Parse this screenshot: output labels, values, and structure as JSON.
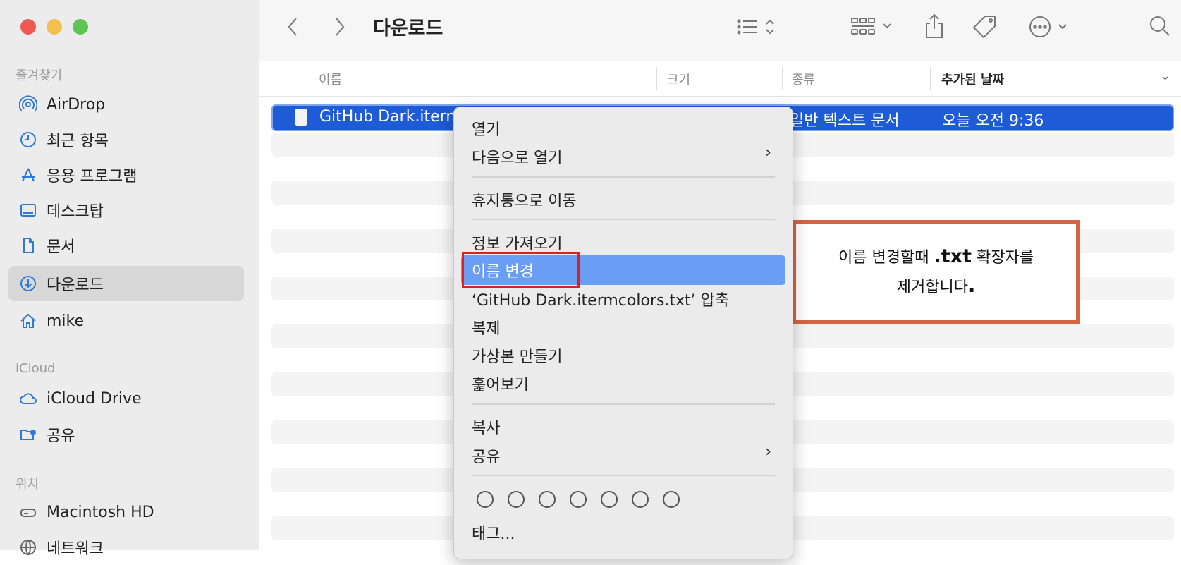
{
  "window": {
    "title": "다운로드"
  },
  "sidebar": {
    "sections": [
      {
        "title": "즐겨찾기",
        "items": [
          {
            "label": "AirDrop",
            "icon": "airdrop-icon"
          },
          {
            "label": "최근 항목",
            "icon": "clock-icon"
          },
          {
            "label": "응용 프로그램",
            "icon": "applications-icon"
          },
          {
            "label": "데스크탑",
            "icon": "desktop-icon"
          },
          {
            "label": "문서",
            "icon": "document-icon"
          },
          {
            "label": "다운로드",
            "icon": "downloads-icon",
            "selected": true
          },
          {
            "label": "mike",
            "icon": "home-icon"
          }
        ]
      },
      {
        "title": "iCloud",
        "items": [
          {
            "label": "iCloud Drive",
            "icon": "cloud-icon"
          },
          {
            "label": "공유",
            "icon": "shared-folder-icon"
          }
        ]
      },
      {
        "title": "위치",
        "items": [
          {
            "label": "Macintosh HD",
            "icon": "disk-icon"
          },
          {
            "label": "네트워크",
            "icon": "network-icon"
          }
        ]
      }
    ]
  },
  "columns": {
    "name": "이름",
    "size": "크기",
    "kind": "종류",
    "date_added": "추가된 날짜"
  },
  "file": {
    "name": "GitHub Dark.iterm",
    "kind": "일반 텍스트 문서",
    "date_added": "오늘 오전 9:36"
  },
  "context_menu": {
    "open": "열기",
    "open_with": "다음으로 열기",
    "move_to_trash": "휴지통으로 이동",
    "get_info": "정보 가져오기",
    "rename": "이름 변경",
    "compress": "‘GitHub Dark.itermcolors.txt’ 압축",
    "duplicate": "복제",
    "make_alias": "가상본 만들기",
    "quick_look": "훑어보기",
    "copy": "복사",
    "share": "공유",
    "tags": "태그...",
    "chevron": "›"
  },
  "annotation": {
    "line1_pre": "이름 변경할때 ",
    "line1_bold": ".txt",
    "line1_post": " 확장자를",
    "line2": "제거합니다",
    "line2_bold": "."
  },
  "colors": {
    "selection": "#1e5bd6",
    "menu_highlight": "#6a9ef5",
    "red_box": "#e02020",
    "annotation_border": "#d66342",
    "sidebar_accent": "#2f7ad8"
  }
}
